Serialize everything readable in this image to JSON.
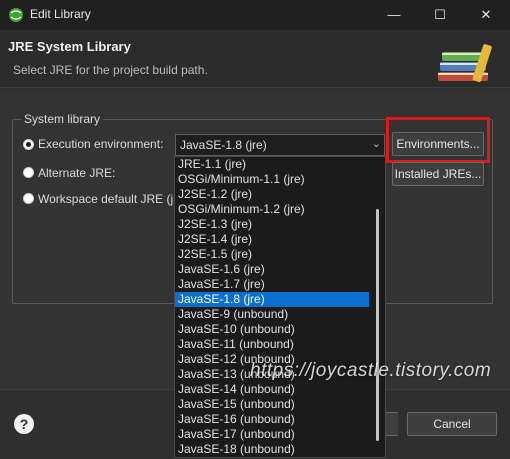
{
  "window": {
    "title": "Edit Library",
    "minimize_glyph": "—",
    "maximize_glyph": "☐",
    "close_glyph": "✕"
  },
  "header": {
    "title": "JRE System Library",
    "description": "Select JRE for the project build path."
  },
  "system_library": {
    "legend": "System library",
    "execution_environment": {
      "label": "Execution environment:",
      "selected": true,
      "value": "JavaSE-1.8 (jre)",
      "arrow": "⌄"
    },
    "alternate_jre": {
      "label": "Alternate JRE:",
      "selected": false,
      "value": ""
    },
    "workspace_default": {
      "label": "Workspace default JRE (jre)",
      "selected": false
    },
    "environments_button": "Environments...",
    "installed_jres_button": "Installed JREs..."
  },
  "dropdown": {
    "items": [
      "JRE-1.1 (jre)",
      "OSGi/Minimum-1.1 (jre)",
      "J2SE-1.2 (jre)",
      "OSGi/Minimum-1.2 (jre)",
      "J2SE-1.3 (jre)",
      "J2SE-1.4 (jre)",
      "J2SE-1.5 (jre)",
      "JavaSE-1.6 (jre)",
      "JavaSE-1.7 (jre)",
      "JavaSE-1.8 (jre)",
      "JavaSE-9 (unbound)",
      "JavaSE-10 (unbound)",
      "JavaSE-11 (unbound)",
      "JavaSE-12 (unbound)",
      "JavaSE-13 (unbound)",
      "JavaSE-14 (unbound)",
      "JavaSE-15 (unbound)",
      "JavaSE-16 (unbound)",
      "JavaSE-17 (unbound)",
      "JavaSE-18 (unbound)"
    ],
    "selected_index": 9
  },
  "footer": {
    "help_glyph": "?",
    "cancel_label": "Cancel"
  },
  "watermark": "https://joycastle.tistory.com",
  "colors": {
    "accent_selection": "#0a6fd1",
    "highlight_box": "#e0191a"
  }
}
